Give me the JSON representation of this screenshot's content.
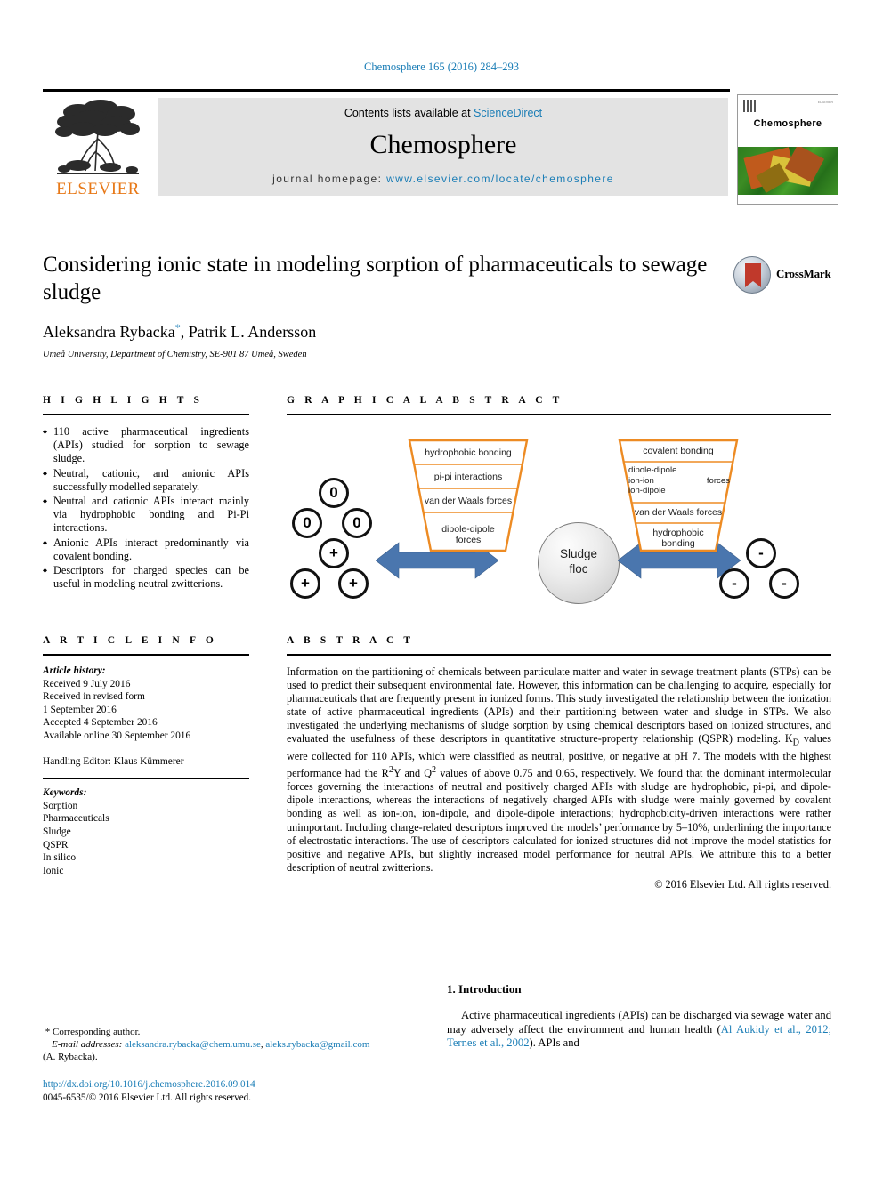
{
  "running_head": "Chemosphere 165 (2016) 284–293",
  "masthead": {
    "contents_prefix": "Contents lists available at ",
    "sciencedirect": "ScienceDirect",
    "journal_title": "Chemosphere",
    "homepage_label": "journal homepage: ",
    "homepage_url": "www.elsevier.com/locate/chemosphere",
    "publisher_logo_text": "ELSEVIER",
    "cover_journal_name": "Chemosphere",
    "cover_tiny_text": "ELSEVIER"
  },
  "article": {
    "title": "Considering ionic state in modeling sorption of pharmaceuticals to sewage sludge",
    "authors": "Aleksandra Rybacka, Patrik L. Andersson",
    "author_star": "*",
    "affiliation": "Umeå University, Department of Chemistry, SE-901 87 Umeå, Sweden",
    "crossmark_label": "CrossMark"
  },
  "highlights": {
    "heading": "H I G H L I G H T S",
    "items": [
      "110 active pharmaceutical ingredients (APIs) studied for sorption to sewage sludge.",
      "Neutral, cationic, and anionic APIs successfully modelled separately.",
      "Neutral and cationic APIs interact mainly via hydrophobic bonding and Pi-Pi interactions.",
      "Anionic APIs interact predominantly via covalent bonding.",
      "Descriptors for charged species can be useful in modeling neutral zwitterions."
    ]
  },
  "graphical_abstract": {
    "heading": "G R A P H I C A L   A B S T R A C T",
    "left_charges": [
      "0",
      "0",
      "0",
      "+",
      "+",
      "+"
    ],
    "right_charges": [
      "-",
      "-",
      "-"
    ],
    "left_trapezoid": [
      "hydrophobic bonding",
      "pi-pi interactions",
      "van der Waals forces",
      "dipole-dipole forces"
    ],
    "right_trapezoid": [
      "covalent bonding",
      "dipole-dipole",
      "ion-ion",
      "ion-dipole",
      "forces",
      "van der Waals forces",
      "hydrophobic bonding"
    ],
    "center_label_line1": "Sludge",
    "center_label_line2": "floc",
    "colors": {
      "trapezoid_border": "#ED8B23",
      "arrow_fill": "#4A76AE",
      "floc_fill": "#DCDCDC"
    }
  },
  "article_info": {
    "heading": "A R T I C L E   I N F O",
    "history_label": "Article history:",
    "history": [
      "Received 9 July 2016",
      "Received in revised form",
      "1 September 2016",
      "Accepted 4 September 2016",
      "Available online 30 September 2016"
    ],
    "handling_editor": "Handling Editor: Klaus Kümmerer",
    "keywords_label": "Keywords:",
    "keywords": [
      "Sorption",
      "Pharmaceuticals",
      "Sludge",
      "QSPR",
      "In silico",
      "Ionic"
    ]
  },
  "abstract": {
    "heading": "A B S T R A C T",
    "body": "Information on the partitioning of chemicals between particulate matter and water in sewage treatment plants (STPs) can be used to predict their subsequent environmental fate. However, this information can be challenging to acquire, especially for pharmaceuticals that are frequently present in ionized forms. This study investigated the relationship between the ionization state of active pharmaceutical ingredients (APIs) and their partitioning between water and sludge in STPs. We also investigated the underlying mechanisms of sludge sorption by using chemical descriptors based on ionized structures, and evaluated the usefulness of these descriptors in quantitative structure-property relationship (QSPR) modeling. KD values were collected for 110 APIs, which were classified as neutral, positive, or negative at pH 7. The models with the highest performance had the R2Y and Q2 values of above 0.75 and 0.65, respectively. We found that the dominant intermolecular forces governing the interactions of neutral and positively charged APIs with sludge are hydrophobic, pi-pi, and dipole-dipole interactions, whereas the interactions of negatively charged APIs with sludge were mainly governed by covalent bonding as well as ion-ion, ion-dipole, and dipole-dipole interactions; hydrophobicity-driven interactions were rather unimportant. Including charge-related descriptors improved the models' performance by 5–10%, underlining the importance of electrostatic interactions. The use of descriptors calculated for ionized structures did not improve the model statistics for positive and negative APIs, but slightly increased model performance for neutral APIs. We attribute this to a better description of neutral zwitterions.",
    "copyright": "© 2016 Elsevier Ltd. All rights reserved."
  },
  "footer": {
    "corresponding_marker": "*",
    "corresponding_label": "Corresponding author.",
    "email_label": "E-mail addresses:",
    "email_1": "aleksandra.rybacka@chem.umu.se",
    "email_2": "aleks.rybacka@gmail.com",
    "email_owner": "(A. Rybacka).",
    "doi_url": "http://dx.doi.org/10.1016/j.chemosphere.2016.09.014",
    "issn_line": "0045-6535/© 2016 Elsevier Ltd. All rights reserved."
  },
  "introduction": {
    "heading": "1. Introduction",
    "paragraph_pre": "Active pharmaceutical ingredients (APIs) can be discharged via sewage water and may adversely affect the environment and human health (",
    "citation": "Al Aukidy et al., 2012; Ternes et al., 2002",
    "paragraph_post": "). APIs and"
  }
}
